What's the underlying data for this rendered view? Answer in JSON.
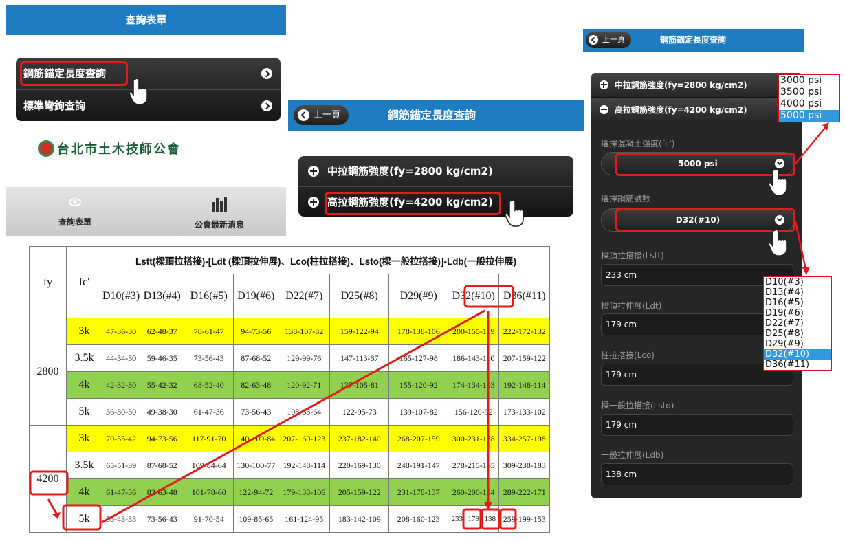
{
  "panel1": {
    "header": "查詢表單",
    "menu": [
      {
        "label": "鋼筋錨定長度查詢"
      },
      {
        "label": "標準彎鉤查詢"
      }
    ],
    "logo": "台北市土木技師公會",
    "tabbar": [
      {
        "label": "查詢表單",
        "icon": "eye-icon"
      },
      {
        "label": "公會最新消息",
        "icon": "bar-chart-icon"
      }
    ]
  },
  "panel2": {
    "back_label": "上一頁",
    "title": "鋼筋錨定長度查詢",
    "accordion": [
      {
        "label": "中拉鋼筋強度(fy=2800 kg/cm2)"
      },
      {
        "label": "高拉鋼筋強度(fy=4200 kg/cm2)"
      }
    ]
  },
  "panel3": {
    "back_label": "上一頁",
    "title": "鋼筋錨定長度查詢",
    "accordion": [
      {
        "label": "中拉鋼筋強度(fy=2800 kg/cm2)",
        "state": "collapsed"
      },
      {
        "label": "高拉鋼筋強度(fy=4200 kg/cm2)",
        "state": "expanded"
      }
    ],
    "concrete_label": "選擇混凝土強度(fc')",
    "concrete_value": "5000 psi",
    "rebar_label": "選擇鋼筋號數",
    "rebar_value": "D32(#10)",
    "fields": [
      {
        "label": "樑頂拉搭接(Lstt)",
        "value": "233 cm"
      },
      {
        "label": "樑頂拉伸展(Ldt)",
        "value": "179 cm"
      },
      {
        "label": "柱拉搭接(Lco)",
        "value": "179 cm"
      },
      {
        "label": "樑一般拉搭接(Lsto)",
        "value": "179 cm"
      },
      {
        "label": "一般拉伸展(Ldb)",
        "value": "138 cm"
      }
    ],
    "concrete_options": [
      "3000 psi",
      "3500 psi",
      "4000 psi",
      "5000 psi"
    ],
    "concrete_selected": 3,
    "rebar_options": [
      "D10(#3)",
      "D13(#4)",
      "D16(#5)",
      "D19(#6)",
      "D22(#7)",
      "D25(#8)",
      "D29(#9)",
      "D32(#10)",
      "D36(#11)"
    ],
    "rebar_selected": 7
  },
  "table": {
    "col_fy": "fy",
    "col_fc": "fc'",
    "title": "Lstt(樑頂拉搭接)-[Ldt (樑頂拉伸展)、Lco(柱拉搭接)、Lsto(樑一般拉搭接)]-Ldb(一般拉伸展)",
    "bars": [
      "D10(#3)",
      "D13(#4)",
      "D16(#5)",
      "D19(#6)",
      "D22(#7)",
      "D25(#8)",
      "D29(#9)",
      "D32(#10)",
      "D36(#11)"
    ],
    "groups": [
      {
        "fy": "2800",
        "rows": [
          {
            "fc": "3k",
            "color": "yellow",
            "values": [
              "47-36-30",
              "62-48-37",
              "78-61-47",
              "94-73-56",
              "138-107-82",
              "159-122-94",
              "178-138-106",
              "200-155-119",
              "222-172-132"
            ]
          },
          {
            "fc": "3.5k",
            "color": "white",
            "values": [
              "44-34-30",
              "59-46-35",
              "73-56-43",
              "87-68-52",
              "129-99-76",
              "147-113-87",
              "165-127-98",
              "186-143-110",
              "207-159-122"
            ]
          },
          {
            "fc": "4k",
            "color": "green",
            "values": [
              "42-32-30",
              "55-42-32",
              "68-52-40",
              "82-63-48",
              "120-92-71",
              "137-105-81",
              "155-120-92",
              "174-134-103",
              "192-148-114"
            ]
          },
          {
            "fc": "5k",
            "color": "white",
            "values": [
              "36-30-30",
              "49-38-30",
              "61-47-36",
              "73-56-43",
              "108-83-64",
              "122-95-73",
              "139-107-82",
              "156-120-92",
              "173-133-102"
            ]
          }
        ]
      },
      {
        "fy": "4200",
        "rows": [
          {
            "fc": "3k",
            "color": "yellow",
            "values": [
              "70-55-42",
              "94-73-56",
              "117-91-70",
              "140-109-84",
              "207-160-123",
              "237-182-140",
              "268-207-159",
              "300-231-178",
              "334-257-198"
            ]
          },
          {
            "fc": "3.5k",
            "color": "white",
            "values": [
              "65-51-39",
              "87-68-52",
              "109-84-64",
              "130-100-77",
              "192-148-114",
              "220-169-130",
              "248-191-147",
              "278-215-165",
              "309-238-183"
            ]
          },
          {
            "fc": "4k",
            "color": "green",
            "values": [
              "61-47-36",
              "82-63-48",
              "101-78-60",
              "122-94-72",
              "179-138-106",
              "205-159-122",
              "231-178-137",
              "260-200-154",
              "289-222-171"
            ]
          },
          {
            "fc": "5k",
            "color": "white",
            "values": [
              "55-43-33",
              "73-56-43",
              "91-70-54",
              "109-85-65",
              "161-124-95",
              "183-142-109",
              "208-160-123",
              "233",
              "179",
              "138",
              "259-199-153"
            ]
          }
        ]
      }
    ]
  },
  "colors": {
    "header_blue": "#1f7cc0",
    "highlight_red": "#e21b1b",
    "yellow": "#ffff00",
    "green": "#92d050"
  }
}
